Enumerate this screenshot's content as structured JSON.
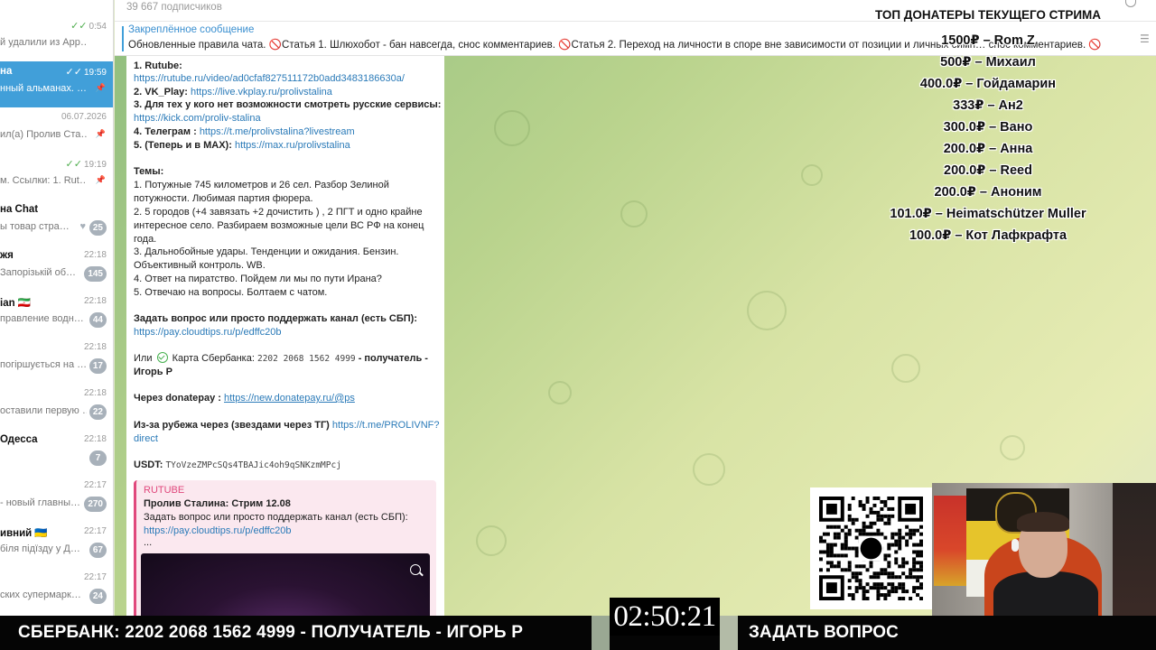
{
  "chat_list": [
    {
      "name": "",
      "time": "0:54",
      "preview": "й удалили из App…",
      "check": true
    },
    {
      "name": "на",
      "time": "19:59",
      "preview": "нный альманах. …",
      "check": true,
      "active": true,
      "pin": true
    },
    {
      "name": "",
      "time": "06.07.2026",
      "preview": "ил(а) Пролив Ста…",
      "pin": true
    },
    {
      "name": "",
      "time": "19:19",
      "preview": "м.  Ссылки: 1. Rut…",
      "check": true,
      "pin": true
    },
    {
      "name": "на Chat",
      "time": "",
      "preview": "ы товар стра…",
      "badge": "25",
      "heart": true
    },
    {
      "name": "жя",
      "time": "22:18",
      "preview": "Запорізькій об…",
      "badge": "145"
    },
    {
      "name": "ian 🇮🇷",
      "time": "22:18",
      "preview": "правление водн…",
      "badge": "44"
    },
    {
      "name": "",
      "time": "22:18",
      "preview": "погіршується на …",
      "badge": "17"
    },
    {
      "name": "",
      "time": "22:18",
      "preview": "оставили первую …",
      "badge": "22"
    },
    {
      "name": "Одесса",
      "time": "22:18",
      "preview": "",
      "badge": "7"
    },
    {
      "name": "",
      "time": "22:17",
      "preview": "- новый главны…",
      "badge": "270"
    },
    {
      "name": "ивний 🇺🇦",
      "time": "22:17",
      "preview": "біля підїзду у Д…",
      "badge": "67"
    },
    {
      "name": "",
      "time": "22:17",
      "preview": "ских супермарк…",
      "badge": "24"
    }
  ],
  "header": {
    "subscribers": "39 667 подписчиков"
  },
  "pinned": {
    "title": "Закреплённое сообщение",
    "text": "Обновленные правила чата. 🚫Статья 1. Шлюхобот - бан навсегда, снос комментариев. 🚫Статья 2. Переход на личности в споре вне зависимости от позиции и личных симп… снос комментариев. 🚫"
  },
  "message": {
    "l1": "1. Rutube:",
    "l2": "https://rutube.ru/video/ad0cfaf827511172b0add3483186630a/",
    "l3a": "2. VK_Play: ",
    "l3b": "https://live.vkplay.ru/prolivstalina",
    "l4": "3. Для тех у кого нет возможности смотреть русские сервисы:",
    "l5": "https://kick.com/proliv-stalina",
    "l6a": "4. Телеграм : ",
    "l6b": "https://t.me/prolivstalina?livestream",
    "l7a": "5. (Теперь и в MAX): ",
    "l7b": "https://max.ru/prolivstalina",
    "topics": "Темы:",
    "t1": "1. Потужные 745 километров и 26 сел. Разбор Зелиной",
    "t1b": "потужности. Любимая партия фюрера.",
    "t2": "2. 5 городов (+4 завязать +2 дочистить ) , 2 ПГТ и одно крайне",
    "t2b": "интересное село. Разбираем возможные цели ВС РФ на конец",
    "t2c": "года.",
    "t3": "3. Дальнобойные удары. Тенденции и ожидания. Бензин.",
    "t3b": "Объективный контроль. WB.",
    "t4": "4. Ответ на пиратство. Пойдем ли мы по пути Ирана?",
    "t5": "5. Отвечаю на вопросы. Болтаем с чатом.",
    "support": "Задать вопрос или просто поддержать канал (есть СБП):",
    "support_link": "https://pay.cloudtips.ru/p/edffc20b",
    "card_a": "Или ",
    "card_b": " Карта Сбербанка: ",
    "card_num": "2202 2068 1562 4999",
    "card_c": " - получатель -",
    "card_name": "Игорь Р",
    "donatepay_label": "Через donatepay : ",
    "donatepay_link": "https://new.donatepay.ru/@ps",
    "abroad_label": "Из-за рубежа через (звездами через ТГ) ",
    "abroad_link": "https://t.me/PROLIVNF?",
    "abroad_link2": "direct",
    "usdt_label": "USDT: ",
    "usdt_value": "TYoVzeZMPcSQs4TBAJic4oh9qSNKzmMPcj"
  },
  "preview_card": {
    "source": "RUTUBE",
    "title": "Пролив Сталина: Стрим 12.08",
    "desc": "Задать вопрос или просто поддержать канал (есть СБП):",
    "link": "https://pay.cloudtips.ru/p/edffc20b",
    "more": "..."
  },
  "donors": {
    "title": "ТОП ДОНАТЕРЫ ТЕКУЩЕГО СТРИМА",
    "items": [
      "1500₽ – Rom Z",
      "500₽ – Михаил",
      "400.0₽ – Гойдамарин",
      "333₽ – Ан2",
      "300.0₽ – Вано",
      "200.0₽ – Анна",
      "200.0₽ – Reed",
      "200.0₽ – Аноним",
      "101.0₽ – Heimatschützer Muller",
      "100.0₽ – Кот Лафкрафта"
    ]
  },
  "bottom": {
    "sberbank": "СБЕРБАНК: 2202 2068 1562 4999 - ПОЛУЧАТЕЛЬ - ИГОРЬ Р",
    "timer": "02:50:21",
    "ask": "ЗАДАТЬ ВОПРОС"
  },
  "colors": {
    "accent": "#419fd9",
    "link": "#2a7ab8",
    "rutube": "#e0487c",
    "unread_badge": "#a8b1ba",
    "read_check": "#4fae4e"
  }
}
